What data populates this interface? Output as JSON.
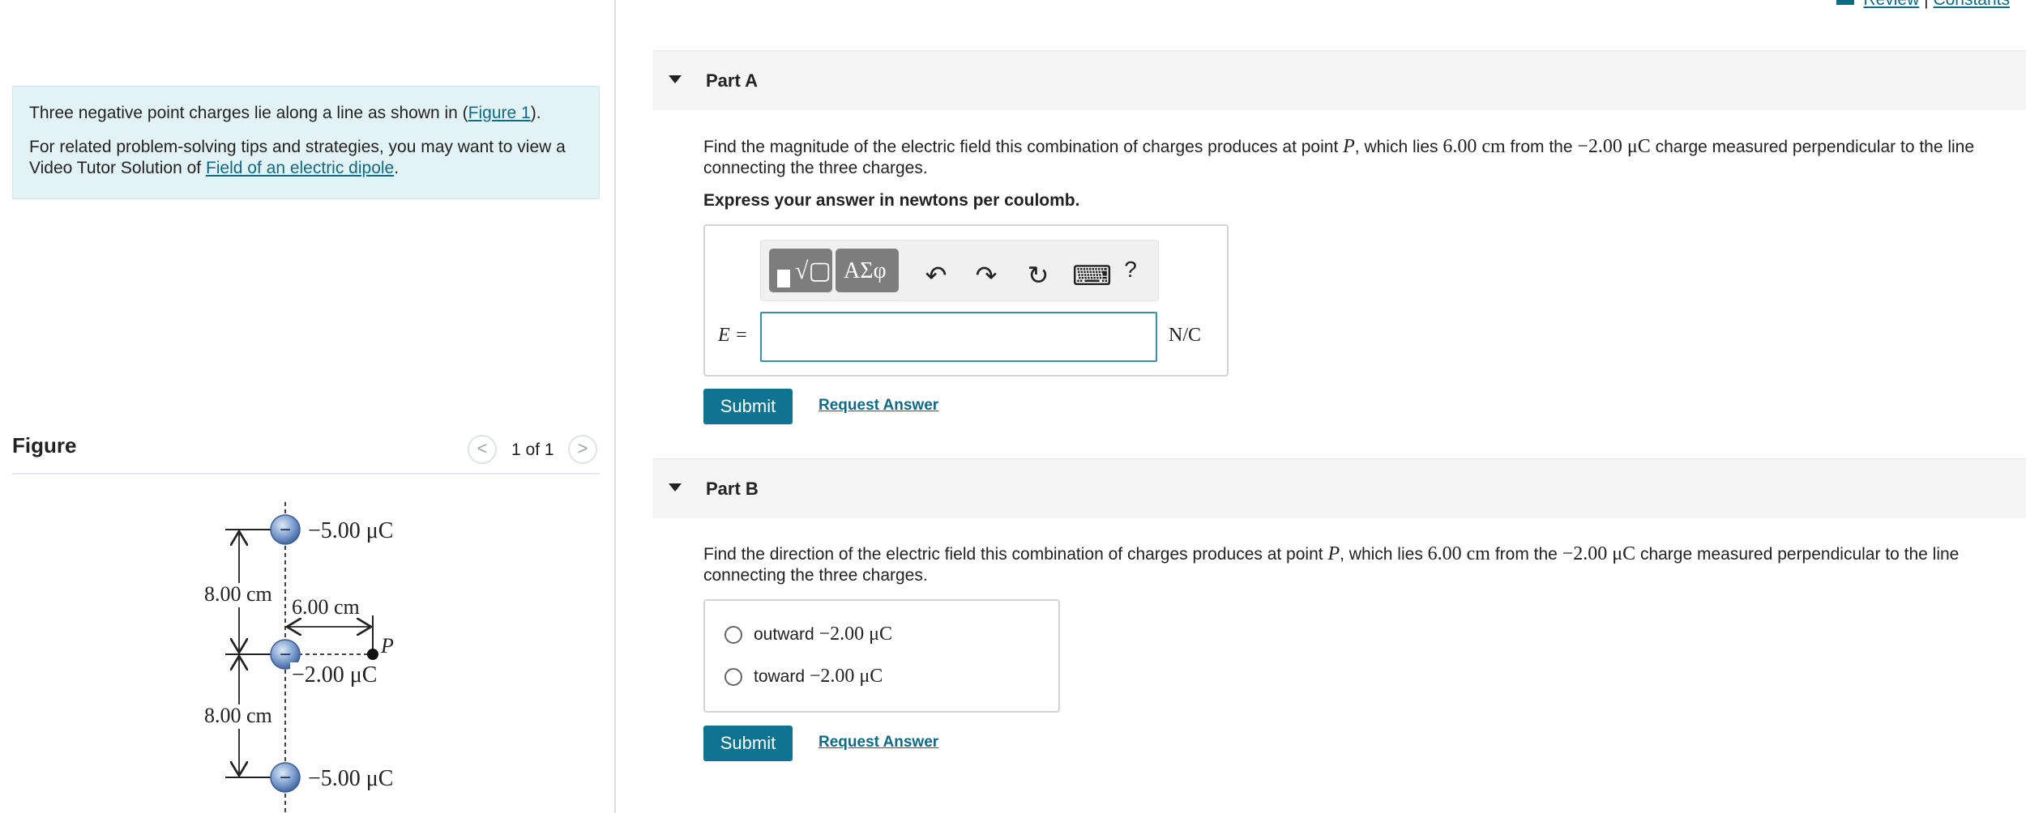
{
  "top_links": {
    "review": "Review",
    "separator": "|",
    "constants": "Constants"
  },
  "intro": {
    "line1_prefix": "Three negative point charges lie along a line as shown in (",
    "line1_link": "Figure 1",
    "line1_suffix": ").",
    "line2_prefix": "For related problem-solving tips and strategies, you may want to view a Video Tutor Solution of ",
    "line2_link": "Field of an electric dipole",
    "line2_suffix": "."
  },
  "figure": {
    "title": "Figure",
    "pager": "1 of 1",
    "prev_glyph": "<",
    "next_glyph": ">",
    "labels": {
      "top_charge": "−5.00 μC",
      "middle_charge": "−2.00 μC",
      "bottom_charge": "−5.00 μC",
      "upper_distance": "8.00 cm",
      "lower_distance": "8.00 cm",
      "horizontal_distance": "6.00 cm",
      "point": "P",
      "charge_sign": "−"
    }
  },
  "part_a": {
    "title": "Part A",
    "question_part1": "Find the magnitude of the electric field this combination of charges produces at point ",
    "question_var": "P",
    "question_part2": ", which lies ",
    "question_dist": "6.00 cm",
    "question_part3": " from the ",
    "question_charge": "−2.00 μC",
    "question_part4": " charge measured perpendicular to the line connecting the three charges.",
    "instruction": "Express your answer in newtons per coulomb.",
    "toolbar": {
      "templates_label": "√▢",
      "symbols_label": "ΑΣφ",
      "undo": "↶",
      "redo": "↷",
      "reset": "↻",
      "keyboard": "⌨",
      "help": "?"
    },
    "variable_label": "E =",
    "input_value": "",
    "unit": "N/C",
    "submit": "Submit",
    "request_answer": "Request Answer"
  },
  "part_b": {
    "title": "Part B",
    "question_part1": "Find the direction of the electric field this combination of charges produces at point ",
    "question_var": "P",
    "question_part2": ", which lies ",
    "question_dist": "6.00 cm",
    "question_part3": " from the ",
    "question_charge": "−2.00 μC",
    "question_part4": " charge measured perpendicular to the line connecting the three charges.",
    "options": [
      {
        "word": "outward",
        "charge": "−2.00 μC"
      },
      {
        "word": "toward",
        "charge": "−2.00 μC"
      }
    ],
    "submit": "Submit",
    "request_answer": "Request Answer"
  },
  "colors": {
    "accent": "#0f7391",
    "intro_bg": "#e3f3f5",
    "charge_fill": "#6f93c9"
  }
}
